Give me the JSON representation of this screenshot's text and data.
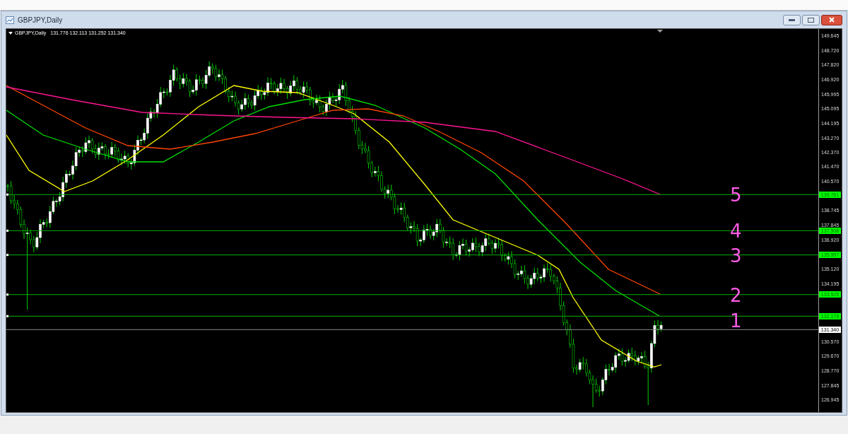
{
  "window": {
    "title": "GBPJPY,Daily"
  },
  "chart": {
    "header": {
      "symbol": "GBPJPY,Daily",
      "ohlc": "131.776 132.113 131.252 131.340"
    },
    "price_axis": [
      "149.645",
      "148.720",
      "147.820",
      "146.920",
      "145.995",
      "145.095",
      "144.195",
      "143.270",
      "142.370",
      "141.470",
      "140.570",
      "138.745",
      "137.845",
      "136.920",
      "135.120",
      "134.195",
      "130.570",
      "129.670",
      "128.770",
      "127.845",
      "126.945"
    ],
    "levels": [
      {
        "price": "139.761",
        "note": "5"
      },
      {
        "price": "137.508",
        "note": "4"
      },
      {
        "price": "135.997",
        "note": "3"
      },
      {
        "price": "133.525",
        "note": "2"
      },
      {
        "price": "132.179",
        "note": "1"
      }
    ],
    "current_price": "131.340"
  }
}
